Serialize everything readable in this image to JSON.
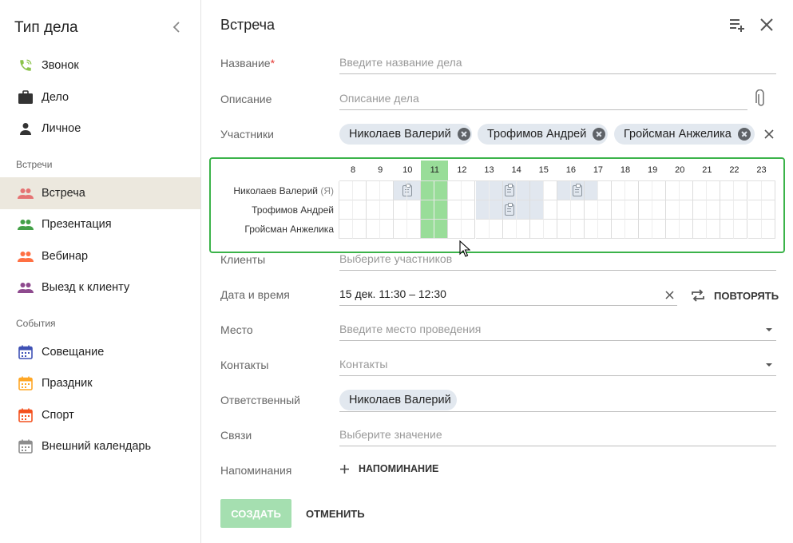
{
  "sidebar": {
    "title": "Тип дела",
    "items": [
      {
        "label": "Звонок",
        "icon": "phone-icon",
        "color": "#8bc34a"
      },
      {
        "label": "Дело",
        "icon": "briefcase-icon",
        "color": "#333333"
      },
      {
        "label": "Личное",
        "icon": "person-icon",
        "color": "#333333"
      }
    ],
    "section_meetings": "Встречи",
    "meetings": [
      {
        "label": "Встреча",
        "icon": "group-icon",
        "color": "#e57373",
        "active": true
      },
      {
        "label": "Презентация",
        "icon": "group-icon",
        "color": "#43a047"
      },
      {
        "label": "Вебинар",
        "icon": "group-icon",
        "color": "#ff7043"
      },
      {
        "label": "Выезд к клиенту",
        "icon": "group-icon",
        "color": "#8e4a8e"
      }
    ],
    "section_events": "События",
    "events": [
      {
        "label": "Совещание",
        "icon": "calendar-icon",
        "color": "#3f51b5"
      },
      {
        "label": "Праздник",
        "icon": "calendar-icon",
        "color": "#ffa726"
      },
      {
        "label": "Спорт",
        "icon": "calendar-icon",
        "color": "#f4511e"
      },
      {
        "label": "Внешний календарь",
        "icon": "calendar-icon",
        "color": "#8d8d8d"
      }
    ]
  },
  "form": {
    "title": "Встреча",
    "name_label": "Название",
    "name_required_mark": "*",
    "name_placeholder": "Введите название дела",
    "desc_label": "Описание",
    "desc_placeholder": "Описание дела",
    "participants_label": "Участники",
    "participants": [
      "Николаев Валерий",
      "Трофимов Андрей",
      "Гройсман Анжелика"
    ],
    "clients_label": "Клиенты",
    "clients_placeholder": "Выберите участников",
    "datetime_label": "Дата и время",
    "datetime_value": "15 дек. 11:30 – 12:30",
    "repeat_label": "ПОВТОРЯТЬ",
    "place_label": "Место",
    "place_placeholder": "Введите место проведения",
    "contacts_label": "Контакты",
    "contacts_placeholder": "Контакты",
    "responsible_label": "Ответственный",
    "responsible_value": "Николаев Валерий",
    "links_label": "Связи",
    "links_placeholder": "Выберите значение",
    "reminders_label": "Напоминания",
    "add_reminder_label": "НАПОМИНАНИЕ",
    "create_label": "СОЗДАТЬ",
    "cancel_label": "ОТМЕНИТЬ"
  },
  "schedule": {
    "hours": [
      "8",
      "9",
      "10",
      "11",
      "12",
      "13",
      "14",
      "15",
      "16",
      "17",
      "18",
      "19",
      "20",
      "21",
      "22",
      "23"
    ],
    "rows": [
      {
        "name": "Николаев Валерий",
        "suffix": "(Я)"
      },
      {
        "name": "Трофимов Андрей",
        "suffix": ""
      },
      {
        "name": "Гройсман Анжелика",
        "suffix": ""
      }
    ],
    "busy": [
      {
        "row": 0,
        "from_hour": 10,
        "to_hour": 11
      },
      {
        "row": 0,
        "from_hour": 13,
        "to_hour": 15.5
      },
      {
        "row": 0,
        "from_hour": 16,
        "to_hour": 17.5
      },
      {
        "row": 1,
        "from_hour": 13,
        "to_hour": 15.5
      }
    ],
    "selection": {
      "from_hour": 11,
      "to_hour": 12
    },
    "colors": {
      "selection": "#99dd99",
      "busy": "#e1e7ef",
      "frame": "#3bb34a"
    }
  }
}
